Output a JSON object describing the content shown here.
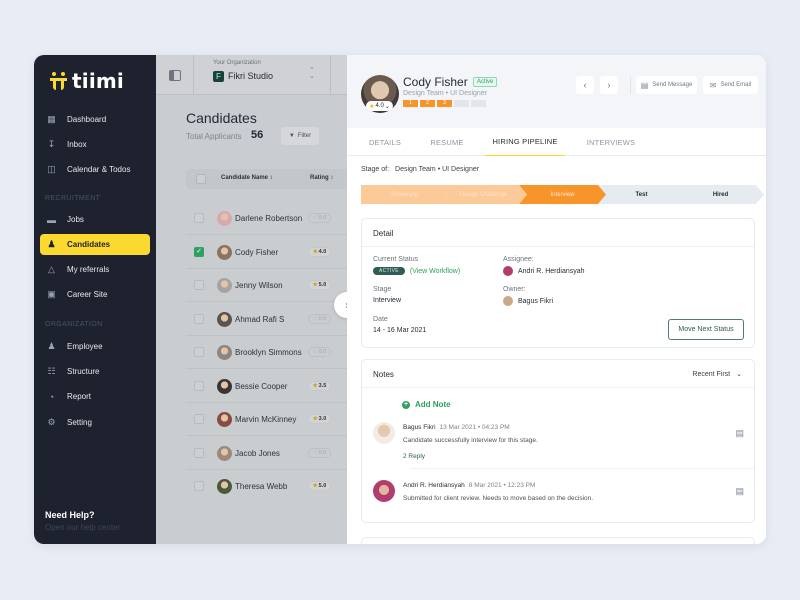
{
  "app": {
    "name": "tiimi",
    "brand_color": "#fbd92f"
  },
  "sidebar": {
    "items": [
      {
        "label": "Dashboard",
        "icon": "dashboard-icon"
      },
      {
        "label": "Inbox",
        "icon": "inbox-icon"
      },
      {
        "label": "Calendar & Todos",
        "icon": "calendar-icon"
      }
    ],
    "recruitment_label": "RECRUITMENT",
    "recruitment_items": [
      {
        "label": "Jobs",
        "icon": "briefcase-icon"
      },
      {
        "label": "Candidates",
        "icon": "candidates-icon",
        "active": true
      },
      {
        "label": "My referrals",
        "icon": "referrals-icon"
      },
      {
        "label": "Career Site",
        "icon": "career-site-icon"
      }
    ],
    "organization_label": "ORGANIZATION",
    "organization_items": [
      {
        "label": "Employee",
        "icon": "employee-icon"
      },
      {
        "label": "Structure",
        "icon": "structure-icon"
      },
      {
        "label": "Report",
        "icon": "report-icon"
      },
      {
        "label": "Setting",
        "icon": "settings-icon"
      }
    ],
    "help_title": "Need Help?",
    "help_subtitle": "Open our help center"
  },
  "org": {
    "label": "Your Organization",
    "name": "Fikri Studio",
    "logo_letter": "F"
  },
  "list": {
    "title": "Candidates",
    "total_label": "Total Applicants",
    "total": "56",
    "filter_label": "Filter",
    "columns": {
      "name": "Candidate Name ↕",
      "rating": "Rating ↕"
    },
    "rows": [
      {
        "name": "Darlene Robertson",
        "rating": "0.0",
        "rated": false,
        "checked": false,
        "avatar": "#d7a9b0"
      },
      {
        "name": "Cody Fisher",
        "rating": "4.0",
        "rated": true,
        "checked": true,
        "avatar": "#8b7362"
      },
      {
        "name": "Jenny Wilson",
        "rating": "5.0",
        "rated": true,
        "checked": false,
        "avatar": "#a9a3a0"
      },
      {
        "name": "Ahmad Rafi S",
        "rating": "0.0",
        "rated": false,
        "checked": false,
        "avatar": "#5e544e"
      },
      {
        "name": "Brooklyn Simmons",
        "rating": "0.0",
        "rated": false,
        "checked": false,
        "avatar": "#8d8580"
      },
      {
        "name": "Bessie Cooper",
        "rating": "3.5",
        "rated": true,
        "checked": false,
        "avatar": "#3b3533"
      },
      {
        "name": "Marvin McKinney",
        "rating": "3.0",
        "rated": true,
        "checked": false,
        "avatar": "#8a4b43"
      },
      {
        "name": "Jacob Jones",
        "rating": "0.0",
        "rated": false,
        "checked": false,
        "avatar": "#9b8a7c"
      },
      {
        "name": "Theresa Webb",
        "rating": "5.0",
        "rated": true,
        "checked": false,
        "avatar": "#4c5a3a"
      }
    ]
  },
  "candidate": {
    "name": "Cody Fisher",
    "status": "Active",
    "team": "Design Team",
    "role": "UI Designer",
    "subtitle": "Design Team  •  UI Designer",
    "rating": "4.0",
    "steps": [
      "1",
      "2",
      "3",
      "",
      ""
    ],
    "steps_completed": 3
  },
  "header_actions": {
    "prev": "‹",
    "next": "›",
    "send_message": "Send Message",
    "send_email": "Send Email"
  },
  "tabs": [
    {
      "label": "DETAILS"
    },
    {
      "label": "RESUME"
    },
    {
      "label": "HIRING PIPELINE",
      "active": true
    },
    {
      "label": "INTERVIEWS"
    }
  ],
  "pipeline": {
    "stage_of_label": "Stage of:",
    "stage_of_value": "Design Team • UI Designer",
    "stages": [
      {
        "label": "Screening",
        "state": "done"
      },
      {
        "label": "Design Challenge",
        "state": "done"
      },
      {
        "label": "Interview",
        "state": "current"
      },
      {
        "label": "Test",
        "state": "todo"
      },
      {
        "label": "Hired",
        "state": "todo"
      }
    ],
    "colors": {
      "done": "#fcc998",
      "current": "#f7952a",
      "todo": "#e6ebf1"
    }
  },
  "detail": {
    "title": "Detail",
    "current_status_label": "Current Status",
    "current_status": "ACTIVE",
    "view_workflow": "(View Workflow)",
    "stage_label": "Stage",
    "stage": "Interview",
    "date_label": "Date",
    "date": "14 - 16 Mar 2021",
    "assignee_label": "Assignee:",
    "assignee": "Andri R. Herdiansyah",
    "owner_label": "Owner:",
    "owner": "Bagus Fikri",
    "move_button": "Move Next Status"
  },
  "notes": {
    "title": "Notes",
    "sort": "Recent First",
    "add_note": "Add Note",
    "items": [
      {
        "author": "Bagus Fikri",
        "time": "13 Mar 2021 • 04:23 PM",
        "text": "Candidate successfully interview for this stage.",
        "reply": "2 Reply",
        "avatar": "#d9c3ad"
      },
      {
        "author": "Andri R. Herdiansyah",
        "time": "8 Mar 2021 • 12:23 PM",
        "text": "Submitted for client review. Needs to move based on the decision.",
        "reply": "",
        "avatar": "#b13d6e"
      }
    ]
  }
}
